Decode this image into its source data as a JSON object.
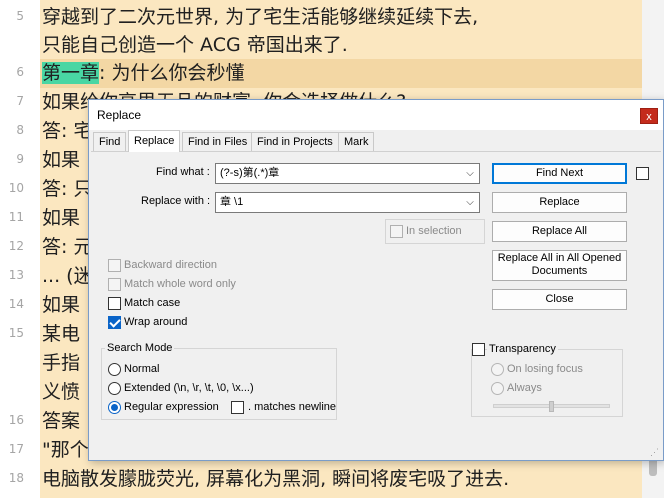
{
  "editor": {
    "lines": [
      {
        "num": "5",
        "text": "穿越到了二次元世界, 为了宅生活能够继续延续下去,"
      },
      {
        "num": "",
        "text": "只能自己创造一个 ACG 帝国出来了."
      },
      {
        "num": "6",
        "text_highlight": "第一章",
        "text_rest": ": 为什么你会秒懂",
        "current": true
      },
      {
        "num": "7",
        "text": "如果给你高里无品的财富, 你会选择做什么?"
      },
      {
        "num": "8",
        "text": "答: 宅"
      },
      {
        "num": "9",
        "text": "如果"
      },
      {
        "num": "10",
        "text": "答: 只"
      },
      {
        "num": "11",
        "text": "如果"
      },
      {
        "num": "12",
        "text": "答: 元"
      },
      {
        "num": "13",
        "text": "... (迷"
      },
      {
        "num": "14",
        "text": "如果"
      },
      {
        "num": "15",
        "text": "某电"
      },
      {
        "num": "",
        "text": "手指"
      },
      {
        "num": "",
        "text": "义愤"
      },
      {
        "num": "16",
        "text": "答案"
      },
      {
        "num": "17",
        "text": "\"那个黑客那么无聊啊\"都装一下, 废宅草出国中."
      },
      {
        "num": "18",
        "text": "电脑散发朦胧荧光, 屏幕化为黑洞, 瞬间将废宅吸了进去."
      }
    ]
  },
  "dialog": {
    "title": "Replace",
    "close_glyph": "x",
    "tabs": [
      {
        "label": "Find",
        "active": false
      },
      {
        "label": "Replace",
        "active": true
      },
      {
        "label": "Find in Files",
        "active": false
      },
      {
        "label": "Find in Projects",
        "active": false
      },
      {
        "label": "Mark",
        "active": false
      }
    ],
    "find_what_label": "Find what :",
    "find_what_value": "(?-s)第(.*)章",
    "replace_with_label": "Replace with :",
    "replace_with_value": "章 \\1",
    "in_selection_label": "In selection",
    "buttons": {
      "find_next": "Find Next",
      "replace": "Replace",
      "replace_all": "Replace All",
      "replace_all_opened_1": "Replace All in All Opened",
      "replace_all_opened_2": "Documents",
      "close": "Close"
    },
    "options": {
      "backward_direction": "Backward direction",
      "match_whole_word": "Match whole word only",
      "match_case": "Match case",
      "wrap_around": "Wrap around"
    },
    "search_mode": {
      "title": "Search Mode",
      "normal": "Normal",
      "extended": "Extended (\\n, \\r, \\t, \\0, \\x...)",
      "regex": "Regular expression",
      "matches_newline": ". matches newline"
    },
    "transparency": {
      "title": "Transparency",
      "on_losing_focus": "On losing focus",
      "always": "Always",
      "level": 0.5
    },
    "arrow_glyph": "⌵",
    "grip_glyph": "⋰"
  }
}
